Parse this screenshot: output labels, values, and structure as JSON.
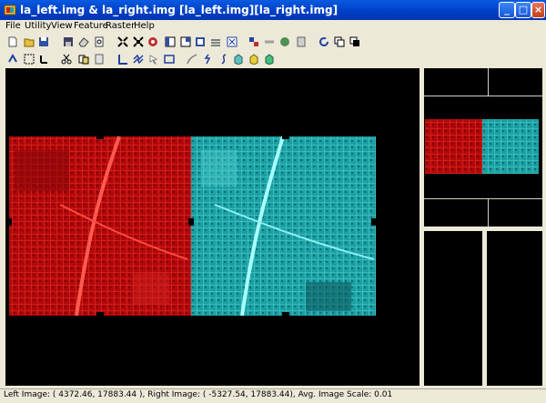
{
  "window": {
    "title": "la_left.img & la_right.img [la_left.img][la_right.img]",
    "minimize_glyph": "_",
    "maximize_glyph": "□",
    "close_glyph": "×"
  },
  "menu": [
    "File",
    "Utility",
    "View",
    "Feature",
    "Raster",
    "Help"
  ],
  "toolbar1": [
    "new-file-icon",
    "open-folder-icon",
    "save-icon",
    "save-as-icon",
    "eraser-icon",
    "print-preview-icon",
    "expand-icon",
    "collapse-icon",
    "link-icon",
    "single-view-icon",
    "dual-view-icon",
    "overview-icon",
    "layers-icon",
    "ruler-icon",
    "fit-window-icon",
    "colors-icon",
    "line-style-icon",
    "globe-icon",
    "reset-icon",
    "refresh-icon",
    "copy-icon",
    "paste-icon"
  ],
  "toolbar2": [
    "pan-icon",
    "select-rect-icon",
    "move-point-icon",
    "cut-icon",
    "link-points-icon",
    "unlink-points-icon",
    "measure-icon",
    "polyline-icon",
    "pointer-icon",
    "box-icon",
    "curve-icon",
    "zigzag-icon",
    "snake-icon",
    "cube-icon",
    "cube-stack-icon",
    "cube-green-icon"
  ],
  "colors": {
    "left_image": "#b8090c",
    "right_image": "#1ea6aa",
    "titlebar": "#0040c8"
  },
  "status": {
    "text": "Left Image: ( 4372.46, 17883.44 ), Right Image: ( -5327.54, 17883.44), Avg. Image Scale: 0.01"
  }
}
